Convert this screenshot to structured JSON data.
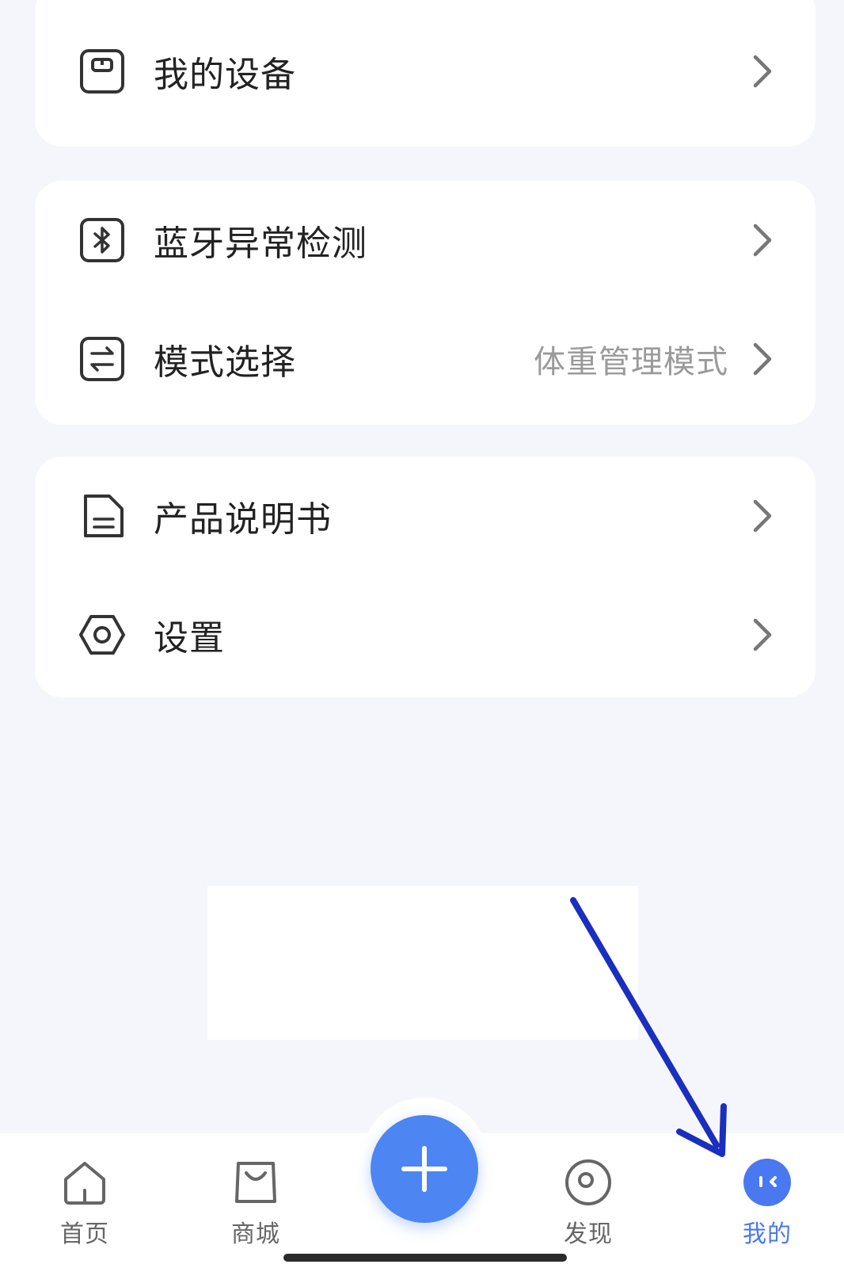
{
  "menu": {
    "my_devices": {
      "label": "我的设备",
      "icon": "scale-icon"
    },
    "bluetooth_check": {
      "label": "蓝牙异常检测",
      "icon": "bluetooth-icon"
    },
    "mode_select": {
      "label": "模式选择",
      "value": "体重管理模式",
      "icon": "switch-arrows-icon"
    },
    "manual": {
      "label": "产品说明书",
      "icon": "document-icon"
    },
    "settings": {
      "label": "设置",
      "icon": "hexagon-gear-icon"
    }
  },
  "tabbar": {
    "home": {
      "label": "首页",
      "icon": "house-icon"
    },
    "mall": {
      "label": "商城",
      "icon": "shopping-bag-icon"
    },
    "add": {
      "icon": "plus-icon"
    },
    "discover": {
      "label": "发现",
      "icon": "compass-icon"
    },
    "mine": {
      "label": "我的",
      "icon": "face-avatar-icon",
      "active": true
    }
  },
  "colors": {
    "accent": "#4d86f2",
    "annotation_arrow": "#1a2fbf",
    "background": "#f5f6fb"
  }
}
